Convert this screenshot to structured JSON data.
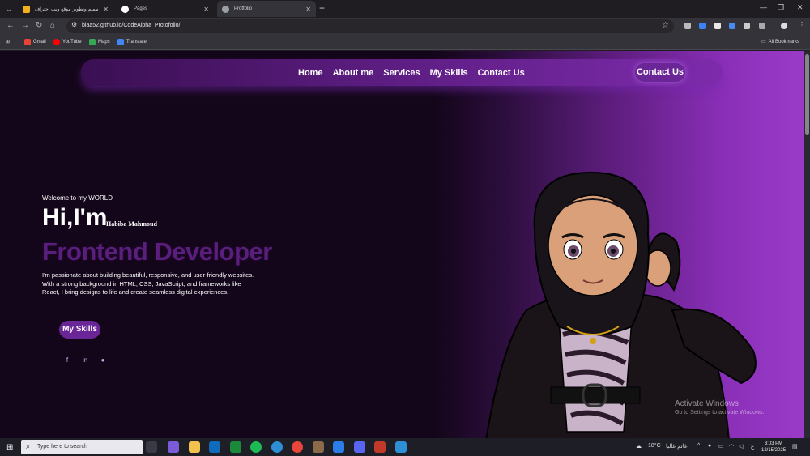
{
  "browser": {
    "tabs": [
      {
        "title": "تصميم وتطوير موقع ويب احتراف",
        "favicon_color": "#f2b01e",
        "active": false
      },
      {
        "title": "Pages",
        "favicon_color": "#ffffff",
        "active": false
      },
      {
        "title": "Protfolio",
        "favicon_color": "#9aa0a6",
        "active": true
      }
    ],
    "url": "biaa52.github.io/CodeAlpha_Protofolio/",
    "bookmarks": [
      "Gmail",
      "YouTube",
      "Maps",
      "Translate"
    ],
    "all_bookmarks": "All Bookmarks"
  },
  "nav": {
    "links": [
      "Home",
      "About me",
      "Services",
      "My Skills",
      "Contact Us"
    ],
    "cta": "Contact Us"
  },
  "hero": {
    "welcome": "Welcome to my WORLD",
    "hi": "Hi,I'm",
    "name": "Habiba Mahmoud",
    "role": "Frontend Developer",
    "description": "I'm passionate about building beautiful, responsive, and user-friendly websites. With a strong background in HTML, CSS, JavaScript, and frameworks like React, I bring designs to life and create seamless digital experiences.",
    "skills_button": "My Skills",
    "social": [
      "facebook-icon",
      "linkedin-icon",
      "github-icon"
    ]
  },
  "watermark": {
    "line1": "Activate Windows",
    "line2": "Go to Settings to activate Windows."
  },
  "taskbar": {
    "search_placeholder": "Type here to search",
    "weather": "18°C",
    "weather_text": "غائم غالبا",
    "lang": "ع",
    "time": "3:03 PM",
    "date": "12/15/2025"
  },
  "colors": {
    "accent": "#6a2596",
    "role_text": "#5a1e7c",
    "bg_dark": "#14061a",
    "bg_right": "#9a3bc8"
  }
}
